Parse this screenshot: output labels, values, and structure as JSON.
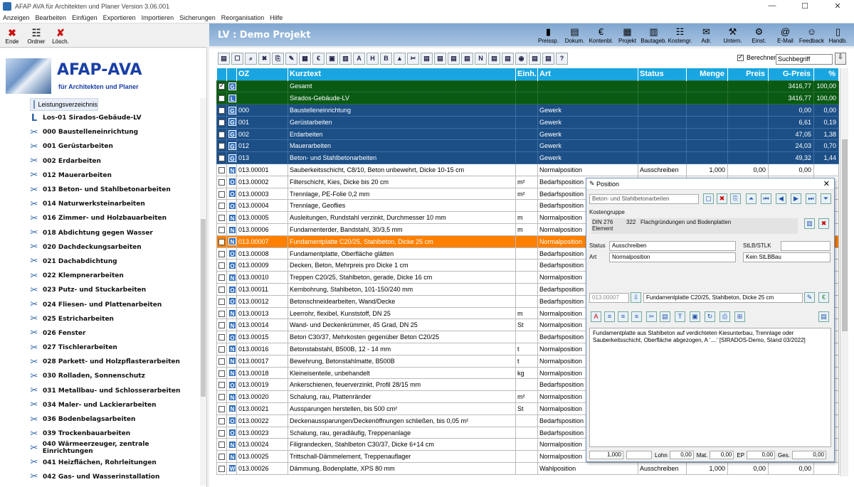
{
  "window": {
    "title": "AFAP AVA für Architekten und Planer Version 3.06.001",
    "minimize": "—",
    "maximize": "☐",
    "close": "✕"
  },
  "menu": [
    "Anzeigen",
    "Bearbeiten",
    "Einfügen",
    "Exportieren",
    "Importieren",
    "Sicherungen",
    "Reorganisation",
    "Hilfe"
  ],
  "left_toolbar": [
    {
      "label": "Ende",
      "icon": "exit-icon",
      "glyph": "✖",
      "color": "#cc1111"
    },
    {
      "label": "Ordner",
      "icon": "folder-tree-icon",
      "glyph": "☷",
      "color": "#333"
    },
    {
      "label": "Lösch.",
      "icon": "delete-icon",
      "glyph": "✘",
      "color": "#cc1111"
    }
  ],
  "lv_title": "LV : Demo Projekt",
  "right_toolbar": [
    {
      "label": "Preissp.",
      "icon": "chart-icon",
      "glyph": "▮"
    },
    {
      "label": "Dokum.",
      "icon": "document-icon",
      "glyph": "▤"
    },
    {
      "label": "Kontenbl.",
      "icon": "euro-icon",
      "glyph": "€"
    },
    {
      "label": "Projekt",
      "icon": "project-icon",
      "glyph": "▦"
    },
    {
      "label": "Bautageb.",
      "icon": "book-icon",
      "glyph": "▥"
    },
    {
      "label": "Kostengr.",
      "icon": "cost-group-icon",
      "glyph": "☷"
    },
    {
      "label": "Adr.",
      "icon": "address-icon",
      "glyph": "✉"
    },
    {
      "label": "Untern.",
      "icon": "company-icon",
      "glyph": "⚒"
    },
    {
      "label": "Einst.",
      "icon": "settings-icon",
      "glyph": "⚙"
    },
    {
      "label": "E-Mail",
      "icon": "email-icon",
      "glyph": "@"
    },
    {
      "label": "Feedback",
      "icon": "feedback-icon",
      "glyph": "☺"
    },
    {
      "label": "Handb.",
      "icon": "manual-icon",
      "glyph": "▯"
    }
  ],
  "logo": {
    "title": "AFAP-AVA",
    "subtitle": "für Architekten und Planer"
  },
  "tree": {
    "root": "Leistungsverzeichnis",
    "items": [
      {
        "label": "Los-01  Sirados-Gebäude-LV",
        "glyph": "L"
      },
      {
        "label": "000 Baustelleneinrichtung",
        "glyph": "✂"
      },
      {
        "label": "001 Gerüstarbeiten",
        "glyph": "✂"
      },
      {
        "label": "002 Erdarbeiten",
        "glyph": "✂"
      },
      {
        "label": "012 Mauerarbeiten",
        "glyph": "✂"
      },
      {
        "label": "013 Beton- und Stahlbetonarbeiten",
        "glyph": "✂"
      },
      {
        "label": "014 Naturwerksteinarbeiten",
        "glyph": "✂"
      },
      {
        "label": "016 Zimmer- und Holzbauarbeiten",
        "glyph": "✂"
      },
      {
        "label": "018 Abdichtung gegen Wasser",
        "glyph": "✂"
      },
      {
        "label": "020 Dachdeckungsarbeiten",
        "glyph": "✂"
      },
      {
        "label": "021 Dachabdichtung",
        "glyph": "✂"
      },
      {
        "label": "022 Klempnerarbeiten",
        "glyph": "✂"
      },
      {
        "label": "023 Putz- und Stuckarbeiten",
        "glyph": "✂"
      },
      {
        "label": "024 Fliesen- und Plattenarbeiten",
        "glyph": "✂"
      },
      {
        "label": "025 Estricharbeiten",
        "glyph": "✂"
      },
      {
        "label": "026 Fenster",
        "glyph": "✂"
      },
      {
        "label": "027 Tischlerarbeiten",
        "glyph": "✂"
      },
      {
        "label": "028 Parkett- und Holzpflasterarbeiten",
        "glyph": "✂"
      },
      {
        "label": "030 Rolladen, Sonnenschutz",
        "glyph": "✂"
      },
      {
        "label": "031 Metallbau- und Schlosserarbeiten",
        "glyph": "✂"
      },
      {
        "label": "034 Maler- und Lackierarbeiten",
        "glyph": "✂"
      },
      {
        "label": "036 Bodenbelagsarbeiten",
        "glyph": "✂"
      },
      {
        "label": "039 Trockenbauarbeiten",
        "glyph": "✂"
      },
      {
        "label": "040 Wärmeerzeuger, zentrale Einrichtungen",
        "glyph": "✂"
      },
      {
        "label": "041 Heizflächen, Rohrleitungen",
        "glyph": "✂"
      },
      {
        "label": "042 Gas- und Wasserinstallation",
        "glyph": "✂"
      }
    ]
  },
  "grid_toolbar": [
    "▤",
    "☐",
    "⌕",
    "✖",
    "⎘",
    "✎",
    "▦",
    "€",
    "▣",
    "▥",
    "A",
    "H",
    "B",
    "▲",
    "✂",
    "▤",
    "▤",
    "▤",
    "▤",
    "N",
    "▤",
    "▤",
    "◉",
    "▤",
    "▤",
    "?"
  ],
  "berechnen": "Berechnen",
  "search_value": "Suchbegriff",
  "columns": [
    "",
    "",
    "OZ",
    "Kurztext",
    "Einh.",
    "Art",
    "Status",
    "Menge",
    "Preis",
    "G-Preis",
    "%"
  ],
  "rows": [
    {
      "cls": "g",
      "chk": true,
      "tag": "G",
      "oz": "",
      "text": "Gesamt",
      "unit": "",
      "art": "",
      "status": "",
      "menge": "",
      "preis": "",
      "gpreis": "3416,77",
      "pct": "100,00"
    },
    {
      "cls": "g",
      "chk": false,
      "tag": "L",
      "oz": "",
      "text": "Sirados-Gebäude-LV",
      "unit": "",
      "art": "",
      "status": "",
      "menge": "",
      "preis": "",
      "gpreis": "3416,77",
      "pct": "100,00"
    },
    {
      "cls": "b",
      "chk": false,
      "tag": "G",
      "oz": "000",
      "text": "Baustelleneinrichtung",
      "unit": "",
      "art": "Gewerk",
      "status": "",
      "menge": "",
      "preis": "",
      "gpreis": "0,00",
      "pct": "0,00"
    },
    {
      "cls": "b",
      "chk": false,
      "tag": "G",
      "oz": "001",
      "text": "Gerüstarbeiten",
      "unit": "",
      "art": "Gewerk",
      "status": "",
      "menge": "",
      "preis": "",
      "gpreis": "6,61",
      "pct": "0,19"
    },
    {
      "cls": "b",
      "chk": false,
      "tag": "G",
      "oz": "002",
      "text": "Erdarbeiten",
      "unit": "",
      "art": "Gewerk",
      "status": "",
      "menge": "",
      "preis": "",
      "gpreis": "47,05",
      "pct": "1,38"
    },
    {
      "cls": "b",
      "chk": false,
      "tag": "G",
      "oz": "012",
      "text": "Mauerarbeiten",
      "unit": "",
      "art": "Gewerk",
      "status": "",
      "menge": "",
      "preis": "",
      "gpreis": "24,03",
      "pct": "0,70"
    },
    {
      "cls": "b",
      "chk": false,
      "tag": "G",
      "oz": "013",
      "text": "Beton- und Stahlbetonarbeiten",
      "unit": "",
      "art": "Gewerk",
      "status": "",
      "menge": "",
      "preis": "",
      "gpreis": "49,32",
      "pct": "1,44"
    },
    {
      "cls": "n",
      "chk": false,
      "tag": "N",
      "oz": "013.00001",
      "text": "Sauberkeitsschicht, C8/10, Beton unbewehrt, Dicke 10-15 cm",
      "unit": "",
      "art": "Normalposition",
      "status": "Ausschreiben",
      "menge": "1,000",
      "preis": "0,00",
      "gpreis": "0,00",
      "pct": ""
    },
    {
      "cls": "n",
      "chk": false,
      "tag": "O",
      "oz": "013.00002",
      "text": "Filterschicht, Kies, Dicke bis 20 cm",
      "unit": "m²",
      "art": "Bedarfsposition",
      "status": "",
      "menge": "",
      "preis": "",
      "gpreis": "",
      "pct": ""
    },
    {
      "cls": "n",
      "chk": false,
      "tag": "O",
      "oz": "013.00003",
      "text": "Trennlage, PE-Folie 0,2 mm",
      "unit": "m²",
      "art": "Bedarfsposition",
      "status": "",
      "menge": "",
      "preis": "",
      "gpreis": "",
      "pct": ""
    },
    {
      "cls": "n",
      "chk": false,
      "tag": "O",
      "oz": "013.00004",
      "text": "Trennlage, Geoflies",
      "unit": "",
      "art": "Bedarfsposition",
      "status": "",
      "menge": "",
      "preis": "",
      "gpreis": "",
      "pct": ""
    },
    {
      "cls": "n",
      "chk": false,
      "tag": "N",
      "oz": "013.00005",
      "text": "Ausleitungen, Rundstahl verzinkt, Durchmesser 10 mm",
      "unit": "m",
      "art": "Normalposition",
      "status": "",
      "menge": "",
      "preis": "",
      "gpreis": "",
      "pct": ""
    },
    {
      "cls": "n",
      "chk": false,
      "tag": "N",
      "oz": "013.00006",
      "text": "Fundamenterder, Bandstahl, 30/3,5 mm",
      "unit": "m",
      "art": "Normalposition",
      "status": "",
      "menge": "",
      "preis": "",
      "gpreis": "",
      "pct": ""
    },
    {
      "cls": "sel",
      "chk": false,
      "tag": "N",
      "oz": "013.00007",
      "text": "Fundamentplatte C20/25, Stahlbeton, Dicke 25 cm",
      "unit": "",
      "art": "Normalposition",
      "status": "",
      "menge": "",
      "preis": "",
      "gpreis": "",
      "pct": ""
    },
    {
      "cls": "n",
      "chk": false,
      "tag": "O",
      "oz": "013.00008",
      "text": "Fundamentplatte, Oberfläche glätten",
      "unit": "",
      "art": "Bedarfsposition",
      "status": "",
      "menge": "",
      "preis": "",
      "gpreis": "",
      "pct": ""
    },
    {
      "cls": "n",
      "chk": false,
      "tag": "O",
      "oz": "013.00009",
      "text": "Decken, Beton, Mehrpreis pro Dicke 1 cm",
      "unit": "",
      "art": "Bedarfsposition",
      "status": "",
      "menge": "",
      "preis": "",
      "gpreis": "",
      "pct": ""
    },
    {
      "cls": "n",
      "chk": false,
      "tag": "N",
      "oz": "013.00010",
      "text": "Treppen C20/25, Stahlbeton, gerade, Dicke 16 cm",
      "unit": "",
      "art": "Normalposition",
      "status": "",
      "menge": "",
      "preis": "",
      "gpreis": "",
      "pct": ""
    },
    {
      "cls": "n",
      "chk": false,
      "tag": "O",
      "oz": "013.00011",
      "text": "Kernbohrung, Stahlbeton, 101-150/240 mm",
      "unit": "",
      "art": "Bedarfsposition",
      "status": "",
      "menge": "",
      "preis": "",
      "gpreis": "",
      "pct": ""
    },
    {
      "cls": "n",
      "chk": false,
      "tag": "O",
      "oz": "013.00012",
      "text": "Betonschneidearbeiten, Wand/Decke",
      "unit": "",
      "art": "Bedarfsposition",
      "status": "",
      "menge": "",
      "preis": "",
      "gpreis": "",
      "pct": ""
    },
    {
      "cls": "n",
      "chk": false,
      "tag": "N",
      "oz": "013.00013",
      "text": "Leerrohr, flexibel, Kunststoff, DN 25",
      "unit": "m",
      "art": "Normalposition",
      "status": "",
      "menge": "",
      "preis": "",
      "gpreis": "",
      "pct": ""
    },
    {
      "cls": "n",
      "chk": false,
      "tag": "N",
      "oz": "013.00014",
      "text": "Wand- und Deckenkrümmer, 45 Grad, DN 25",
      "unit": "St",
      "art": "Normalposition",
      "status": "",
      "menge": "",
      "preis": "",
      "gpreis": "",
      "pct": ""
    },
    {
      "cls": "n",
      "chk": false,
      "tag": "O",
      "oz": "013.00015",
      "text": "Beton C30/37, Mehrkosten gegenüber Beton C20/25",
      "unit": "",
      "art": "Bedarfsposition",
      "status": "",
      "menge": "",
      "preis": "",
      "gpreis": "",
      "pct": ""
    },
    {
      "cls": "n",
      "chk": false,
      "tag": "N",
      "oz": "013.00016",
      "text": "Betonstabstahl, B500B, 12 - 14 mm",
      "unit": "t",
      "art": "Normalposition",
      "status": "",
      "menge": "",
      "preis": "",
      "gpreis": "",
      "pct": ""
    },
    {
      "cls": "n",
      "chk": false,
      "tag": "N",
      "oz": "013.00017",
      "text": "Bewehrung, Betonstahlmatte, B500B",
      "unit": "t",
      "art": "Normalposition",
      "status": "",
      "menge": "",
      "preis": "",
      "gpreis": "",
      "pct": ""
    },
    {
      "cls": "n",
      "chk": false,
      "tag": "N",
      "oz": "013.00018",
      "text": "Kleineisenteile, unbehandelt",
      "unit": "kg",
      "art": "Normalposition",
      "status": "",
      "menge": "",
      "preis": "",
      "gpreis": "",
      "pct": ""
    },
    {
      "cls": "n",
      "chk": false,
      "tag": "O",
      "oz": "013.00019",
      "text": "Ankerschienen, feuerverzinkt, Profil 28/15 mm",
      "unit": "",
      "art": "Bedarfsposition",
      "status": "",
      "menge": "",
      "preis": "",
      "gpreis": "",
      "pct": ""
    },
    {
      "cls": "n",
      "chk": false,
      "tag": "N",
      "oz": "013.00020",
      "text": "Schalung, rau, Plattenränder",
      "unit": "m²",
      "art": "Normalposition",
      "status": "",
      "menge": "",
      "preis": "",
      "gpreis": "",
      "pct": ""
    },
    {
      "cls": "n",
      "chk": false,
      "tag": "N",
      "oz": "013.00021",
      "text": "Aussparungen herstellen, bis 500 cm²",
      "unit": "St",
      "art": "Normalposition",
      "status": "",
      "menge": "",
      "preis": "",
      "gpreis": "",
      "pct": ""
    },
    {
      "cls": "n",
      "chk": false,
      "tag": "O",
      "oz": "013.00022",
      "text": "Deckenaussparungen/Deckenöffnungen schließen, bis 0,05 m²",
      "unit": "",
      "art": "Bedarfsposition",
      "status": "",
      "menge": "",
      "preis": "",
      "gpreis": "",
      "pct": ""
    },
    {
      "cls": "n",
      "chk": false,
      "tag": "O",
      "oz": "013.00023",
      "text": "Schalung, rau, geradläufig, Treppenanlage",
      "unit": "",
      "art": "Bedarfsposition",
      "status": "",
      "menge": "",
      "preis": "",
      "gpreis": "",
      "pct": ""
    },
    {
      "cls": "n",
      "chk": false,
      "tag": "N",
      "oz": "013.00024",
      "text": "Filigrandecken, Stahlbeton C30/37, Dicke 6+14 cm",
      "unit": "",
      "art": "Normalposition",
      "status": "",
      "menge": "",
      "preis": "",
      "gpreis": "",
      "pct": ""
    },
    {
      "cls": "n",
      "chk": false,
      "tag": "N",
      "oz": "013.00025",
      "text": "Trittschall-Dämmelement, Treppenauflager",
      "unit": "",
      "art": "Normalposition",
      "status": "",
      "menge": "",
      "preis": "",
      "gpreis": "",
      "pct": ""
    },
    {
      "cls": "n",
      "chk": false,
      "tag": "W",
      "oz": "013.00026",
      "text": "Dämmung, Bodenplatte, XPS 80 mm",
      "unit": "",
      "art": "Wahlposition",
      "status": "Ausschreiben",
      "menge": "1,000",
      "preis": "0,00",
      "gpreis": "0,00",
      "pct": ""
    }
  ],
  "dialog": {
    "title": "Position",
    "parent": "Beton- und Stahlbetonarbeiten",
    "kostengruppe_label": "Kostengruppe",
    "din": "DIN 276",
    "element": "Element",
    "kg_code": "322",
    "kg_text": "Flachgründungen und Bodenplatten",
    "status_label": "Status",
    "status_value": "Ausschreiben",
    "art_label": "Art",
    "art_value": "Normalposition",
    "stlb_label": "StLB/STLK",
    "stlb_select": "Kein StLBBau",
    "oz": "013.00007",
    "kurztext": "Fundamentplatte C20/25, Stahlbeton, Dicke 25 cm",
    "langtext": "Fundamentplatte aus Stahlbeton auf verdichteten Kiesunterbau, Trennlage oder Sauberkeitsschicht, Oberfläche abgezogen, A '....' [SIRADOS-Demo, Stand 03/2022]",
    "menge": "1,000",
    "lohn_label": "Lohn",
    "lohn": "0,00",
    "mat_label": "Mat.",
    "mat": "0,00",
    "ep_label": "EP",
    "ep": "0,00",
    "ges_label": "Ges.",
    "ges": "0,00"
  }
}
